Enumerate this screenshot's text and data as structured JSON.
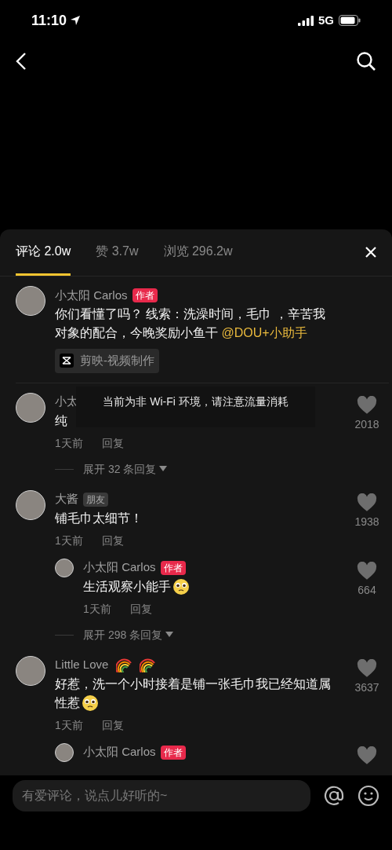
{
  "status_bar": {
    "time": "11:10",
    "network": "5G"
  },
  "sheet": {
    "tabs": [
      {
        "label": "评论 2.0w",
        "selected": true
      },
      {
        "label": "赞 3.7w",
        "selected": false
      },
      {
        "label": "浏览 296.2w",
        "selected": false
      }
    ],
    "comments": [
      {
        "name": "小太阳 Carlos",
        "badge": {
          "kind": "author",
          "label": "作者"
        },
        "text": "你们看懂了吗？ 线索：洗澡时间，毛巾 ，辛苦我对象的配合，今晚奖励小鱼干 ",
        "mention": "@DOU+小助手",
        "attachment": "剪映-视频制作"
      },
      {
        "name": "小太",
        "text": "纯",
        "time": "1天前",
        "reply": "回复",
        "likes": "2018",
        "toast": "当前为非 Wi-Fi 环境，请注意流量消耗",
        "expand": "展开 32 条回复"
      },
      {
        "name": "大酱",
        "badge": {
          "kind": "friend",
          "label": "朋友"
        },
        "text": "铺毛巾太细节！",
        "time": "1天前",
        "reply": "回复",
        "likes": "1938",
        "children": [
          {
            "name": "小太阳 Carlos",
            "badge": {
              "kind": "author",
              "label": "作者"
            },
            "text": "生活观察小能手",
            "text_icons": [
              {
                "kind": "pleading"
              }
            ],
            "time": "1天前",
            "reply": "回复",
            "likes": "664"
          }
        ],
        "expand": "展开 298 条回复"
      },
      {
        "name": "Little Love",
        "name_icons": [
          {
            "kind": "rainbow"
          },
          {
            "kind": "rainbow"
          }
        ],
        "text": "好惹，洗一个小时接着是铺一张毛巾我已经知道属性惹",
        "text_icons": [
          {
            "kind": "pleading"
          }
        ],
        "time": "1天前",
        "reply": "回复",
        "likes": "3637",
        "children": [
          {
            "name": "小太阳 Carlos",
            "badge": {
              "kind": "author",
              "label": "作者"
            },
            "like_button": true
          }
        ]
      }
    ]
  },
  "input": {
    "placeholder": "有爱评论，说点儿好听的~"
  }
}
